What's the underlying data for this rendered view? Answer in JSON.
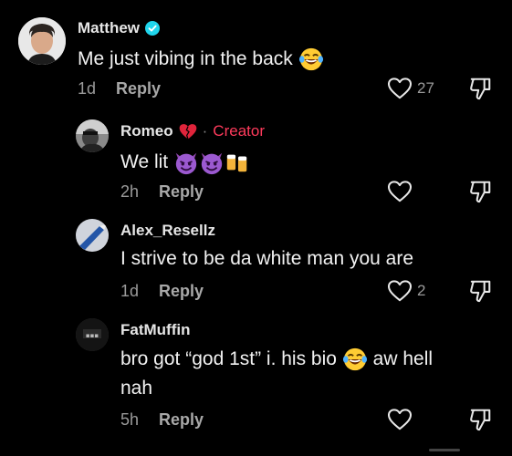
{
  "comments": [
    {
      "username": "Matthew",
      "verified": true,
      "text": "Me just vibing in the back",
      "emoji_after": "laughing-tears",
      "time": "1d",
      "reply_label": "Reply",
      "likes": "27"
    },
    {
      "username": "Romeo",
      "badge": "Creator",
      "text": "We lit",
      "time": "2h",
      "reply_label": "Reply",
      "likes": ""
    },
    {
      "username": "Alex_Resellz",
      "text": "I strive to be da white man you are",
      "time": "1d",
      "reply_label": "Reply",
      "likes": "2"
    },
    {
      "username": "FatMuffin",
      "text_part1": "bro got “god 1st” i. his bio",
      "text_part2": "aw hell",
      "text_line2": "nah",
      "time": "5h",
      "reply_label": "Reply",
      "likes": ""
    }
  ],
  "colors": {
    "background": "#000000",
    "creator_badge": "#ff3b5c",
    "verified": "#20d5ec",
    "muted": "#9a9a9a"
  }
}
